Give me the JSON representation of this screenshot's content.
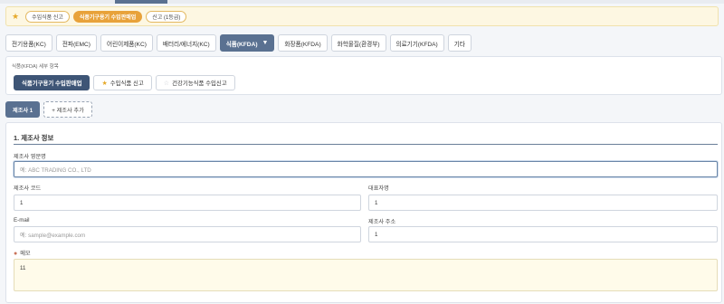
{
  "favorites": {
    "chips": [
      {
        "label": "수입식품 신고",
        "active": false
      },
      {
        "label": "식품기구용기 수입판매업",
        "active": true
      },
      {
        "label": "신고 (1등급)",
        "active": false
      }
    ]
  },
  "tabs": [
    {
      "label": "전기용품(KC)",
      "active": false
    },
    {
      "label": "전파(EMC)",
      "active": false
    },
    {
      "label": "어린이제품(KC)",
      "active": false
    },
    {
      "label": "배터리/에너지(KC)",
      "active": false
    },
    {
      "label": "식품(KFDA)",
      "active": true
    },
    {
      "label": "화장품(KFDA)",
      "active": false
    },
    {
      "label": "화학물질(환경부)",
      "active": false
    },
    {
      "label": "의료기기(KFDA)",
      "active": false
    },
    {
      "label": "기타",
      "active": false
    }
  ],
  "sub_panel": {
    "title": "식품(KFDA) 세부 항목",
    "buttons": [
      {
        "label": "식품기구용기 수입판매업",
        "active": true
      },
      {
        "label": "수입식품 신고",
        "active": false
      },
      {
        "label": "건강기능식품 수입신고",
        "active": false
      }
    ]
  },
  "manufacturer_tabs": {
    "active_label": "제조사 1",
    "add_label": "+ 제조사 추가"
  },
  "form": {
    "section_title": "1. 제조사 정보",
    "name_en": {
      "label": "제조사 영문명",
      "value": "",
      "placeholder": "예: ABC TRADING CO., LTD"
    },
    "code": {
      "label": "제조사 코드",
      "value": "1"
    },
    "ceo": {
      "label": "대표자명",
      "value": "1"
    },
    "email": {
      "label": "E-mail",
      "value": "",
      "placeholder": "예: sample@example.com"
    },
    "address": {
      "label": "제조사 주소",
      "value": "1"
    },
    "memo": {
      "label": "메모",
      "value": "11"
    }
  },
  "colors": {
    "accent": "#5a7191",
    "accent_dark": "#3e5576",
    "favorite": "#e8a23a"
  }
}
